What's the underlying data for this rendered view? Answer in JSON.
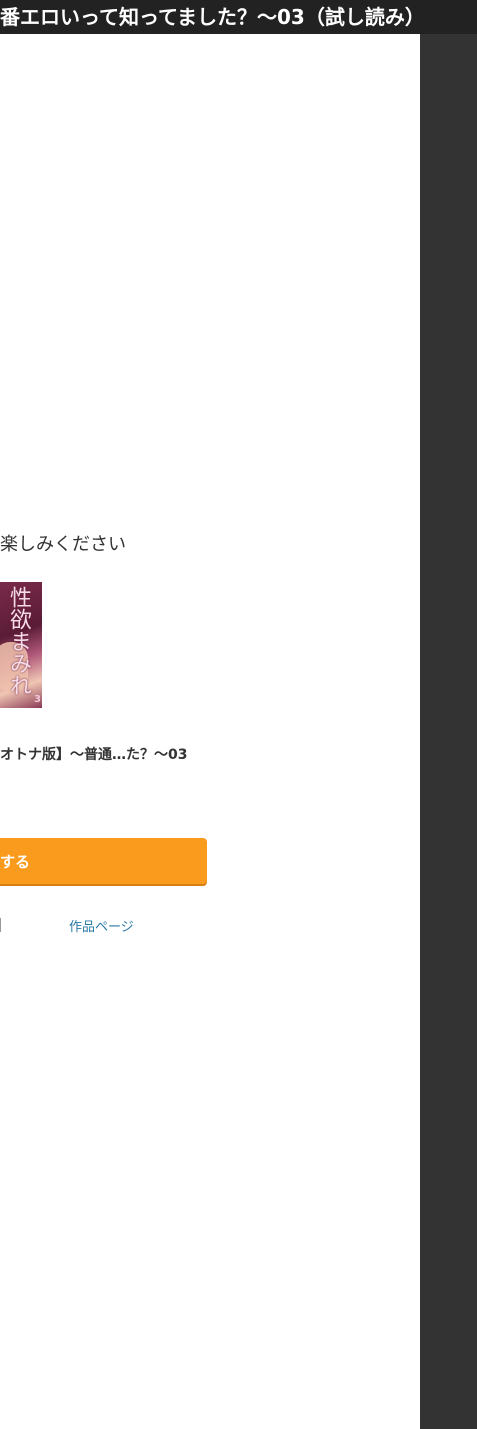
{
  "header": {
    "title": "番エロいって知ってました？〜03（試し読み）"
  },
  "main": {
    "message": "楽しみください",
    "cover": {
      "kanji": "性欲まみれ",
      "badge": "3"
    },
    "work_title": "オトナ版】〜普通…た？〜03",
    "buy_button_label": "する",
    "work_page_link": "作品ページ"
  },
  "colors": {
    "title_bar": "#222222",
    "side_panel": "#333333",
    "buy_button": "#fb9b1e",
    "link": "#2a7aa8"
  }
}
